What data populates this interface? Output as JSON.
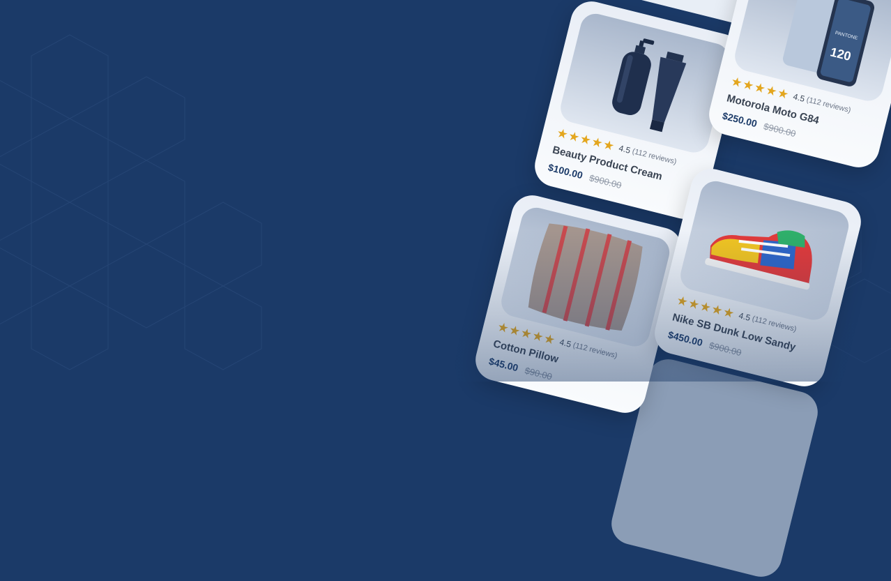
{
  "colors": {
    "background": "#1b3a68",
    "star": "#e3a61e",
    "price": "#1b3a68"
  },
  "products": [
    {
      "title": "Beauty Product Cream",
      "rating": "4.5",
      "reviews": "(112 reviews)",
      "price": "$100.00",
      "old_price": "$900.00",
      "stars": 5,
      "image_icon": "cream-bottles-icon"
    },
    {
      "title": "Motorola Moto G84",
      "rating": "4.5",
      "reviews": "(112 reviews)",
      "price": "$250.00",
      "old_price": "$900.00",
      "stars": 5,
      "image_icon": "smartphone-icon",
      "screen_text_1": "PANTONE",
      "screen_text_2": "120"
    },
    {
      "title": "Cotton Pillow",
      "rating": "4.5",
      "reviews": "(112 reviews)",
      "price": "$45.00",
      "old_price": "$90.00",
      "stars": 5,
      "image_icon": "pillow-icon"
    },
    {
      "title": "Nike SB Dunk Low Sandy",
      "rating": "4.5",
      "reviews": "(112 reviews)",
      "price": "$450.00",
      "old_price": "$900.00",
      "stars": 5,
      "image_icon": "sneaker-icon"
    }
  ]
}
